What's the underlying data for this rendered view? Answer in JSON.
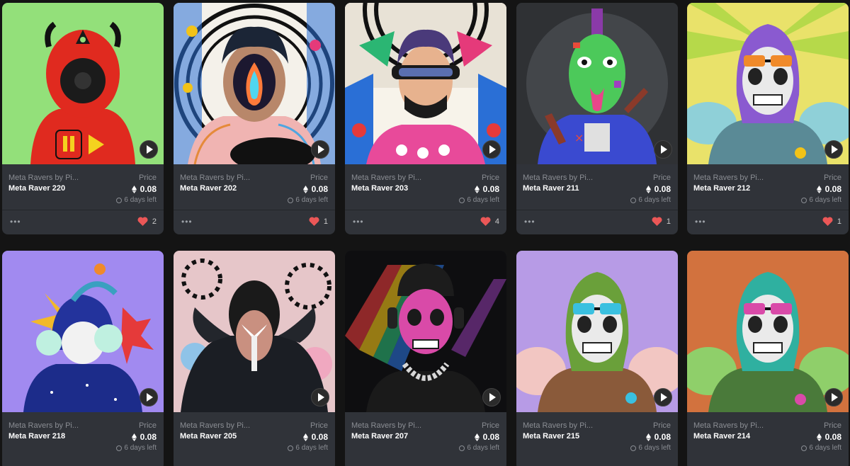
{
  "colors": {
    "page_bg": "#141414",
    "card_bg": "#303339",
    "heart": "#eb5757",
    "muted_text": "#8a8d93"
  },
  "icons": {
    "play": "play-icon",
    "eth": "ethereum-icon",
    "clock": "clock-icon",
    "more": "more-options-icon",
    "favorite": "heart-icon"
  },
  "cards": [
    {
      "collection": "Meta Ravers by Pi...",
      "name": "Meta Raver 220",
      "price_label": "Price",
      "price": "0.08",
      "time_left": "6 days left",
      "likes": "2"
    },
    {
      "collection": "Meta Ravers by Pi...",
      "name": "Meta Raver 202",
      "price_label": "Price",
      "price": "0.08",
      "time_left": "6 days left",
      "likes": "1"
    },
    {
      "collection": "Meta Ravers by Pi...",
      "name": "Meta Raver 203",
      "price_label": "Price",
      "price": "0.08",
      "time_left": "6 days left",
      "likes": "4"
    },
    {
      "collection": "Meta Ravers by Pi...",
      "name": "Meta Raver 211",
      "price_label": "Price",
      "price": "0.08",
      "time_left": "6 days left",
      "likes": "1"
    },
    {
      "collection": "Meta Ravers by Pi...",
      "name": "Meta Raver 212",
      "price_label": "Price",
      "price": "0.08",
      "time_left": "6 days left",
      "likes": "1"
    },
    {
      "collection": "Meta Ravers by Pi...",
      "name": "Meta Raver 218",
      "price_label": "Price",
      "price": "0.08",
      "time_left": "6 days left"
    },
    {
      "collection": "Meta Ravers by Pi...",
      "name": "Meta Raver 205",
      "price_label": "Price",
      "price": "0.08",
      "time_left": "6 days left"
    },
    {
      "collection": "Meta Ravers by Pi...",
      "name": "Meta Raver 207",
      "price_label": "Price",
      "price": "0.08",
      "time_left": "6 days left"
    },
    {
      "collection": "Meta Ravers by Pi...",
      "name": "Meta Raver 215",
      "price_label": "Price",
      "price": "0.08",
      "time_left": "6 days left"
    },
    {
      "collection": "Meta Ravers by Pi...",
      "name": "Meta Raver 214",
      "price_label": "Price",
      "price": "0.08",
      "time_left": "6 days left"
    }
  ]
}
